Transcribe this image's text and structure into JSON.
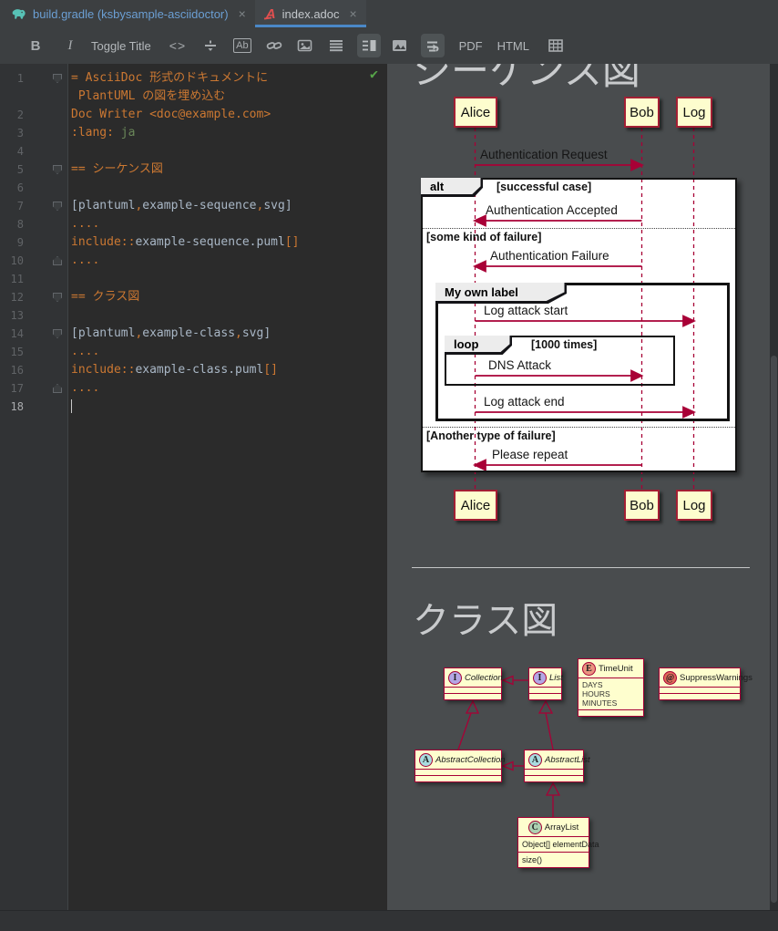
{
  "colors": {
    "accent_blue": "#4a88c7",
    "tab_modified_blue": "#6b9fd4",
    "editor_bg": "#2b2b2b",
    "gutter_bg": "#313335",
    "preview_bg": "#494c4e",
    "plantuml_crimson": "#a80036",
    "plantuml_box_fill": "#fefece",
    "syntax_orange": "#cc7832",
    "syntax_gray": "#a9b7c6",
    "syntax_green": "#6a8759",
    "check_green": "#57a64a"
  },
  "icons": [
    "gradle-elephant-icon",
    "asciidoc-file-icon",
    "close-icon",
    "code-icon",
    "horizontal-rule-icon",
    "inline-code-icon",
    "link-icon",
    "image-icon",
    "list-icon",
    "split-preview-icon",
    "media-icon",
    "auto-scroll-icon",
    "table-icon",
    "fold-marker-icon",
    "checkmark-icon"
  ],
  "tabs": [
    {
      "label": "build.gradle (ksbysample-asciidoctor)",
      "close": "×",
      "active": false
    },
    {
      "label": "index.adoc",
      "close": "×",
      "active": true
    }
  ],
  "toolbar": {
    "bold": "B",
    "italic": "I",
    "toggle_title": "Toggle Title",
    "code": "<>",
    "pdf": "PDF",
    "html": "HTML"
  },
  "editor": {
    "checkmark": "✔",
    "rows": [
      {
        "num": "1",
        "fold": "down",
        "segments": [
          {
            "t": "= AsciiDoc 形式のドキュメントに",
            "c": "kw"
          }
        ]
      },
      {
        "num": "",
        "fold": "",
        "segments": [
          {
            "t": " PlantUML の図を埋め込む",
            "c": "kw"
          }
        ]
      },
      {
        "num": "2",
        "fold": "",
        "segments": [
          {
            "t": "Doc Writer <doc@example.com>",
            "c": "kw"
          }
        ]
      },
      {
        "num": "3",
        "fold": "",
        "segments": [
          {
            "t": ":lang:",
            "c": "kw"
          },
          {
            "t": " ja",
            "c": "str"
          }
        ]
      },
      {
        "num": "4",
        "fold": "",
        "segments": []
      },
      {
        "num": "5",
        "fold": "down",
        "segments": [
          {
            "t": "== シーケンス図",
            "c": "kw"
          }
        ]
      },
      {
        "num": "6",
        "fold": "",
        "segments": []
      },
      {
        "num": "7",
        "fold": "down",
        "segments": [
          {
            "t": "[plantuml",
            "c": "code"
          },
          {
            "t": ",",
            "c": "kw"
          },
          {
            "t": "example-sequence",
            "c": "code"
          },
          {
            "t": ",",
            "c": "kw"
          },
          {
            "t": "svg]",
            "c": "code"
          }
        ]
      },
      {
        "num": "8",
        "fold": "",
        "segments": [
          {
            "t": "....",
            "c": "kw"
          }
        ]
      },
      {
        "num": "9",
        "fold": "",
        "segments": [
          {
            "t": "include::",
            "c": "kw"
          },
          {
            "t": "example-sequence.puml",
            "c": "code"
          },
          {
            "t": "[]",
            "c": "kw"
          }
        ]
      },
      {
        "num": "10",
        "fold": "up",
        "segments": [
          {
            "t": "....",
            "c": "kw"
          }
        ]
      },
      {
        "num": "11",
        "fold": "",
        "segments": []
      },
      {
        "num": "12",
        "fold": "down",
        "segments": [
          {
            "t": "== クラス図",
            "c": "kw"
          }
        ]
      },
      {
        "num": "13",
        "fold": "",
        "segments": []
      },
      {
        "num": "14",
        "fold": "down",
        "segments": [
          {
            "t": "[plantuml",
            "c": "code"
          },
          {
            "t": ",",
            "c": "kw"
          },
          {
            "t": "example-class",
            "c": "code"
          },
          {
            "t": ",",
            "c": "kw"
          },
          {
            "t": "svg]",
            "c": "code"
          }
        ]
      },
      {
        "num": "15",
        "fold": "",
        "segments": [
          {
            "t": "....",
            "c": "kw"
          }
        ]
      },
      {
        "num": "16",
        "fold": "",
        "segments": [
          {
            "t": "include::",
            "c": "kw"
          },
          {
            "t": "example-class.puml",
            "c": "code"
          },
          {
            "t": "[]",
            "c": "kw"
          }
        ]
      },
      {
        "num": "17",
        "fold": "up",
        "segments": [
          {
            "t": "....",
            "c": "kw"
          }
        ]
      },
      {
        "num": "18",
        "fold": "",
        "current": true,
        "segments": []
      }
    ]
  },
  "preview": {
    "heading_sequence": "シーケンス図",
    "heading_class": "クラス図",
    "sequence": {
      "participants": [
        "Alice",
        "Bob",
        "Log"
      ],
      "alt_label": "alt",
      "group_label": "My own label",
      "loop_label": "loop",
      "loop_guard": "[1000 times]",
      "guards": [
        "[successful case]",
        "[some kind of failure]",
        "[Another type of failure]"
      ],
      "messages": [
        "Authentication Request",
        "Authentication Accepted",
        "Authentication Failure",
        "Log attack start",
        "DNS Attack",
        "Log attack end",
        "Please repeat"
      ]
    },
    "classes": {
      "collection": {
        "letter": "I",
        "name": "Collection"
      },
      "list": {
        "letter": "I",
        "name": "List"
      },
      "timeunit": {
        "letter": "E",
        "name": "TimeUnit",
        "values": [
          "DAYS",
          "HOURS",
          "MINUTES"
        ]
      },
      "suppresswarnings": {
        "letter": "@",
        "name": "SuppressWarnings"
      },
      "abstractcollection": {
        "letter": "A",
        "name": "AbstractCollection"
      },
      "abstractlist": {
        "letter": "A",
        "name": "AbstractList"
      },
      "arraylist": {
        "letter": "C",
        "name": "ArrayList",
        "attr": "Object[] elementData",
        "method": "size()"
      }
    }
  }
}
